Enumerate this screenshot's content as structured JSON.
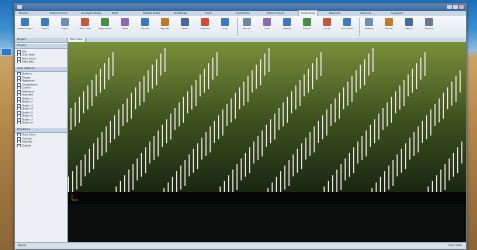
{
  "app": {
    "tabs": [
      "Home",
      "Point Cloud",
      "Analyze Data",
      "Edit",
      "Model Data",
      "Surfaces",
      "Civil",
      "Corridors",
      "Point Cloud",
      "Scanning",
      "Reports",
      "Add-ins",
      "Support"
    ],
    "active_tab": "Scanning"
  },
  "ribbon": {
    "buttons": [
      "Create Project",
      "Import",
      "Export",
      "Scan Vista",
      "Registration",
      "Clean",
      "Surface",
      "Segment",
      "Select",
      "Distance",
      "Crop",
      "Section",
      "Filter",
      "Classify",
      "Extract",
      "Profile",
      "Edit Points",
      "Measure",
      "Render",
      "Report",
      "Options"
    ]
  },
  "side_panel": {
    "header": "Project",
    "sections": [
      {
        "title": "Project",
        "items": [
          "Site",
          "Scan Data",
          "Point Cloud",
          "Data Sets"
        ]
      },
      {
        "title": "Scan Stations",
        "items": [
          "Stations",
          "Targets",
          "Registered",
          "Unregistered",
          "Control",
          "Reference",
          "Imported",
          "Station 1",
          "Station 2",
          "Station 3",
          "Station 4",
          "Station 5",
          "Station 6",
          "Station 7",
          "Station 8"
        ]
      },
      {
        "title": "Properties",
        "items": [
          "Point Cloud",
          "Colorize",
          "Intensity",
          "Classify"
        ]
      }
    ]
  },
  "viewport": {
    "tab": "Plan View"
  },
  "status": {
    "left": "Ready",
    "right": "Scan Vista"
  },
  "colors": {
    "accent": "#3b659a",
    "point_cloud": "#f2f2ee",
    "scene_top": "#7a8f3a",
    "scene_bottom": "#1a2410"
  }
}
